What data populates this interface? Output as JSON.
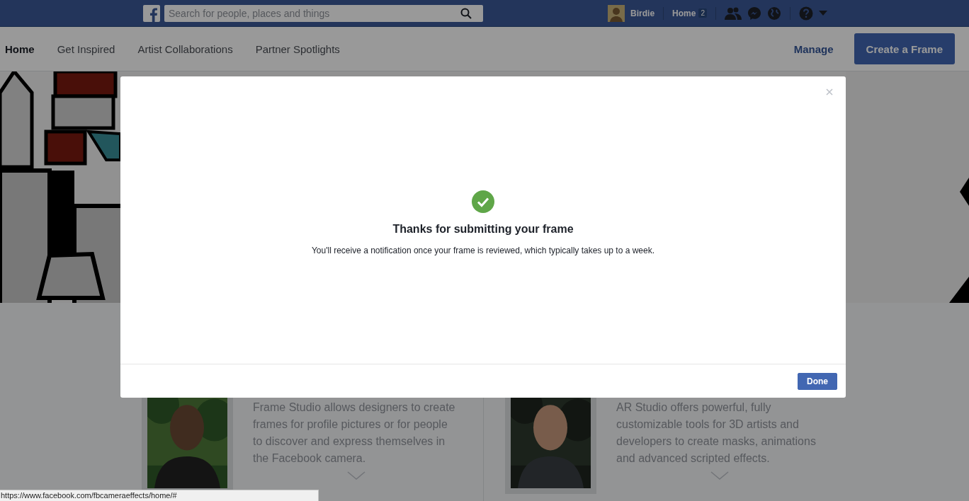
{
  "top_bar": {
    "search": {
      "placeholder": "Search for people, places and things"
    },
    "profile_name": "Birdie",
    "home_link": "Home",
    "home_count": "2"
  },
  "nav": {
    "items": [
      {
        "label": "Home",
        "selected": true
      },
      {
        "label": "Get Inspired",
        "selected": false
      },
      {
        "label": "Artist Collaborations",
        "selected": false
      },
      {
        "label": "Partner Spotlights",
        "selected": false
      }
    ],
    "manage": "Manage",
    "create_button": "Create a Frame"
  },
  "cards": [
    {
      "description": "Frame Studio allows designers to create frames for profile pictures or for people to discover and express themselves in the Facebook camera."
    },
    {
      "description": "AR Studio offers powerful, fully customizable tools for 3D artists and developers to create masks, animations and advanced scripted effects."
    }
  ],
  "dialog": {
    "title": "Thanks for submitting your frame",
    "message": "You'll receive a notification once your frame is reviewed, which typically takes up to a week.",
    "done_button": "Done"
  },
  "status_bar": {
    "url": "https://www.facebook.com/fbcameraeffects/home/#"
  }
}
